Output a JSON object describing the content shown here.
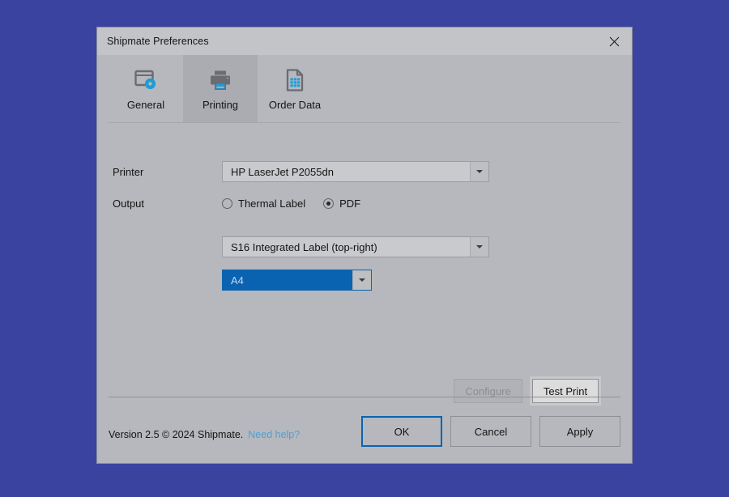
{
  "window": {
    "title": "Shipmate Preferences",
    "close_icon": "close-icon"
  },
  "tabs": [
    {
      "label": "General",
      "icon": "window-gear-icon",
      "active": false
    },
    {
      "label": "Printing",
      "icon": "printer-icon",
      "active": true
    },
    {
      "label": "Order Data",
      "icon": "document-grid-icon",
      "active": false
    }
  ],
  "form": {
    "printer": {
      "label": "Printer",
      "value": "HP LaserJet P2055dn"
    },
    "output": {
      "label": "Output",
      "options": [
        {
          "label": "Thermal Label",
          "selected": false
        },
        {
          "label": "PDF",
          "selected": true
        }
      ]
    },
    "label_format": {
      "value": "S16 Integrated Label (top-right)"
    },
    "paper_size": {
      "value": "A4"
    }
  },
  "actions": {
    "configure": "Configure",
    "test_print": "Test Print"
  },
  "footer": {
    "version": "Version 2.5 © 2024 Shipmate.",
    "help_link": "Need help?",
    "ok": "OK",
    "cancel": "Cancel",
    "apply": "Apply"
  },
  "colors": {
    "desktop": "#3a44a0",
    "dialog": "#b6b8bd",
    "titlebar": "#c2c4c8",
    "accent": "#0a63b0",
    "icon_blue": "#1f9cd6",
    "icon_gray": "#6a6c71",
    "link": "#4f9fd4"
  }
}
